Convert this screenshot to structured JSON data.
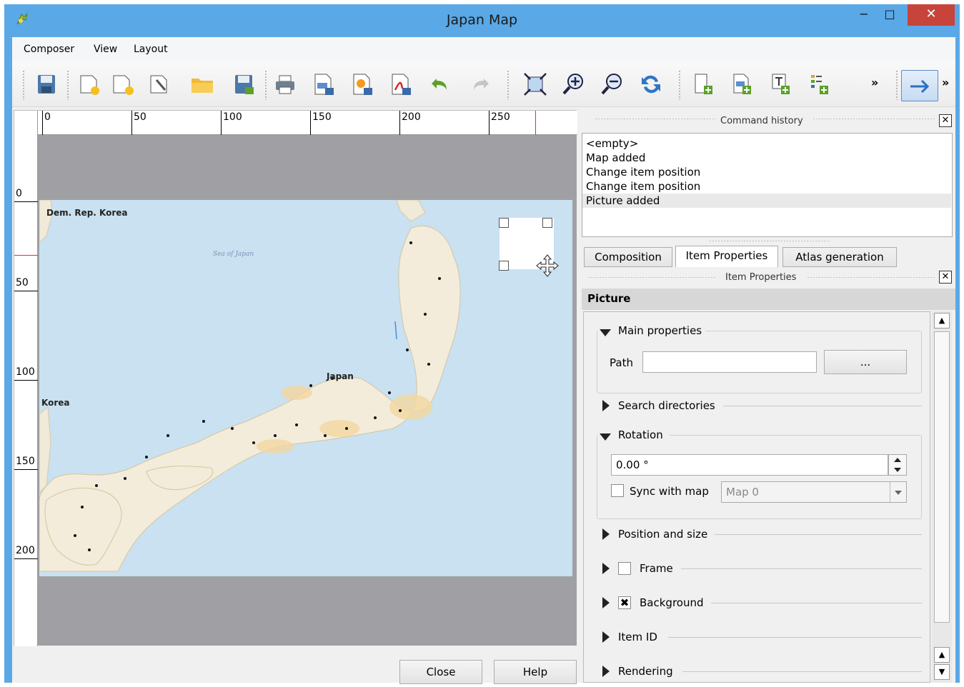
{
  "window": {
    "title": "Japan Map",
    "minimize": "−",
    "maximize": "□",
    "close": "✕"
  },
  "menu": {
    "items": [
      "Composer",
      "View",
      "Layout"
    ]
  },
  "toolbar": {
    "overflow1": "»",
    "overflow2": "»"
  },
  "ruler": {
    "top_labels": [
      "0",
      "50",
      "100",
      "150",
      "200",
      "250"
    ],
    "left_labels": [
      "0",
      "50",
      "100",
      "150",
      "200"
    ]
  },
  "map": {
    "labels": {
      "dem_rep_korea": "Dem. Rep. Korea",
      "korea": "Korea",
      "japan": "Japan",
      "sea_of_japan": "Sea of Japan"
    }
  },
  "buttons": {
    "close": "Close",
    "help": "Help"
  },
  "command_history": {
    "title": "Command history",
    "items": [
      "<empty>",
      "Map added",
      "Change item position",
      "Change item position",
      "Picture added"
    ],
    "selected_index": 4
  },
  "tabs": {
    "composition": "Composition",
    "item_properties": "Item Properties",
    "atlas_generation": "Atlas generation"
  },
  "item_properties": {
    "dock_title": "Item Properties",
    "header": "Picture",
    "main_properties": {
      "title": "Main properties",
      "path_label": "Path",
      "path_value": "",
      "browse_button": "..."
    },
    "search_directories": "Search directories",
    "rotation": {
      "title": "Rotation",
      "value": "0.00 °",
      "sync_label": "Sync with map",
      "sync_checked": false,
      "map_select": "Map 0"
    },
    "position_and_size": "Position and size",
    "frame": {
      "label": "Frame",
      "checked": false
    },
    "background": {
      "label": "Background",
      "checked": true,
      "mark": "✖"
    },
    "item_id": "Item ID",
    "rendering": "Rendering"
  },
  "close_glyph": "✕"
}
